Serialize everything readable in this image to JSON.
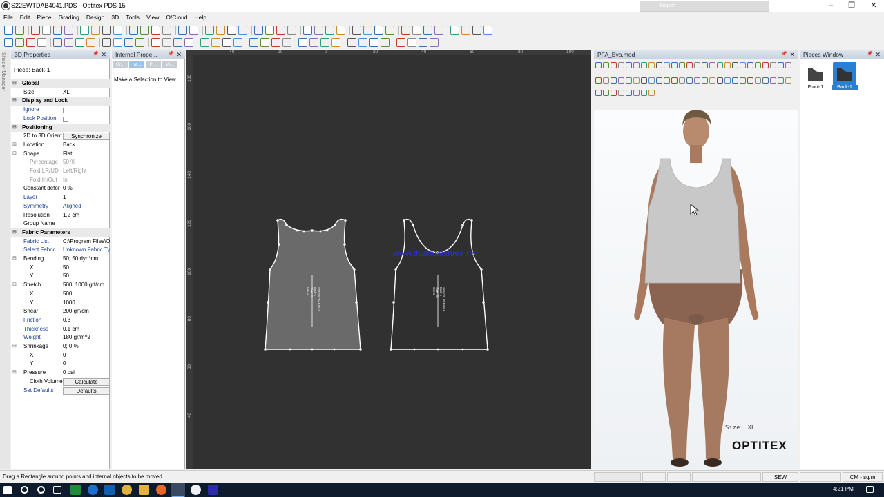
{
  "window": {
    "title": "S22EWTDAB4041.PDS - Optitex PDS 15",
    "lang_label": "English"
  },
  "menu": [
    "File",
    "Edit",
    "Piece",
    "Grading",
    "Design",
    "3D",
    "Tools",
    "View",
    "O/Cloud",
    "Help"
  ],
  "side_tab_label": "Shader Manager",
  "props_panel": {
    "title": "3D Properties",
    "piece_label": "Piece: Back-1",
    "rows": [
      {
        "kind": "section",
        "label": "Global",
        "toggle": "⊟"
      },
      {
        "kind": "field",
        "label": "Size",
        "value": "XL"
      },
      {
        "kind": "section",
        "label": "Display and Lock",
        "toggle": "⊟"
      },
      {
        "kind": "check",
        "label": "Ignore",
        "blue": true
      },
      {
        "kind": "check",
        "label": "Lock Position",
        "blue": true
      },
      {
        "kind": "section",
        "label": "Positioning",
        "toggle": "⊟"
      },
      {
        "kind": "button",
        "label": "2D to 3D Orient",
        "value": "Synchronize"
      },
      {
        "kind": "field",
        "label": "Location",
        "value": "Back",
        "toggle": "⊞"
      },
      {
        "kind": "field",
        "label": "Shape",
        "value": "Flat",
        "toggle": "⊟"
      },
      {
        "kind": "field",
        "label": "Percentage",
        "value": "50 %",
        "sub": true,
        "gray": true
      },
      {
        "kind": "field",
        "label": "Fold LR/UD",
        "value": "Left/Right",
        "sub": true,
        "gray": true
      },
      {
        "kind": "field",
        "label": "Fold In/Out",
        "value": "In",
        "sub": true,
        "gray": true
      },
      {
        "kind": "field",
        "label": "Constant defor",
        "value": "0 %"
      },
      {
        "kind": "field",
        "label": "Layer",
        "value": "1",
        "blue": true
      },
      {
        "kind": "field",
        "label": "Symmetry",
        "value": "Aligned",
        "blue": true,
        "bluev": true
      },
      {
        "kind": "field",
        "label": "Resolution",
        "value": "1.2 cm"
      },
      {
        "kind": "field",
        "label": "Group Name",
        "value": ""
      },
      {
        "kind": "section",
        "label": "Fabric Parameters",
        "toggle": "⊟"
      },
      {
        "kind": "field",
        "label": "Fabric List",
        "value": "C:\\Program Files\\O",
        "blue": true
      },
      {
        "kind": "field",
        "label": "Select Fabric",
        "value": "Unknown Fabric Ty",
        "blue": true,
        "bluev": true
      },
      {
        "kind": "field",
        "label": "Bending",
        "value": "50; 50 dyn*cm",
        "toggle": "⊟"
      },
      {
        "kind": "field",
        "label": "X",
        "value": "50",
        "sub": true
      },
      {
        "kind": "field",
        "label": "Y",
        "value": "50",
        "sub": true
      },
      {
        "kind": "field",
        "label": "Stretch",
        "value": "500; 1000 grf/cm",
        "toggle": "⊟"
      },
      {
        "kind": "field",
        "label": "X",
        "value": "500",
        "sub": true
      },
      {
        "kind": "field",
        "label": "Y",
        "value": "1000",
        "sub": true
      },
      {
        "kind": "field",
        "label": "Shear",
        "value": "200 grf/cm"
      },
      {
        "kind": "field",
        "label": "Friction",
        "value": "0.3",
        "blue": true
      },
      {
        "kind": "field",
        "label": "Thickness",
        "value": "0.1 cm",
        "blue": true
      },
      {
        "kind": "field",
        "label": "Weight",
        "value": "180 gr/m^2",
        "blue": true
      },
      {
        "kind": "field",
        "label": "Shrinkage",
        "value": "0; 0 %",
        "toggle": "⊟"
      },
      {
        "kind": "field",
        "label": "X",
        "value": "0",
        "sub": true
      },
      {
        "kind": "field",
        "label": "Y",
        "value": "0",
        "sub": true
      },
      {
        "kind": "field",
        "label": "Pressure",
        "value": "0 psi",
        "toggle": "⊟"
      },
      {
        "kind": "button",
        "label": "Cloth Volume",
        "value": "Calculate",
        "sub": true
      },
      {
        "kind": "button",
        "label": "Set Defaults",
        "value": "Defaults",
        "blue": true
      }
    ]
  },
  "internal_panel": {
    "title": "Internal Prope...",
    "tabs": [
      "Gr...",
      "Int...",
      "Pi...",
      "Ve..."
    ],
    "message": "Make a Selection to View Properties"
  },
  "canvas": {
    "watermark": "www.thuthuatshare.net",
    "h_ruler": [
      "-40",
      "-20",
      "0",
      "20",
      "40",
      "60",
      "80",
      "100"
    ],
    "v_ruler": [
      "180",
      "160",
      "140",
      "120",
      "100",
      "80",
      "60",
      "40"
    ],
    "piece_text": [
      "S22EWTDAB4041",
      "Back-1",
      "Size: XL",
      "Cut: 1"
    ]
  },
  "pfa_panel": {
    "title": "PFA_Eva.mod",
    "size_label": "Size: XL",
    "brand": "OPTITEX"
  },
  "pieces_panel": {
    "title": "Pieces Window",
    "items": [
      {
        "label": "Front-1",
        "selected": false
      },
      {
        "label": "Back-1",
        "selected": true
      }
    ]
  },
  "status": {
    "message": "Drag a Rectangle around points and internal objects to be moved",
    "mode": "SEW",
    "units": "CM - sq.m"
  },
  "taskbar": {
    "time": "4:21 PM"
  },
  "colors": {
    "canvas_bg": "#313131",
    "piece_fill": "#6a6a6a",
    "selected_piece": "#2a7fd4",
    "watermark": "#2a30d8"
  }
}
